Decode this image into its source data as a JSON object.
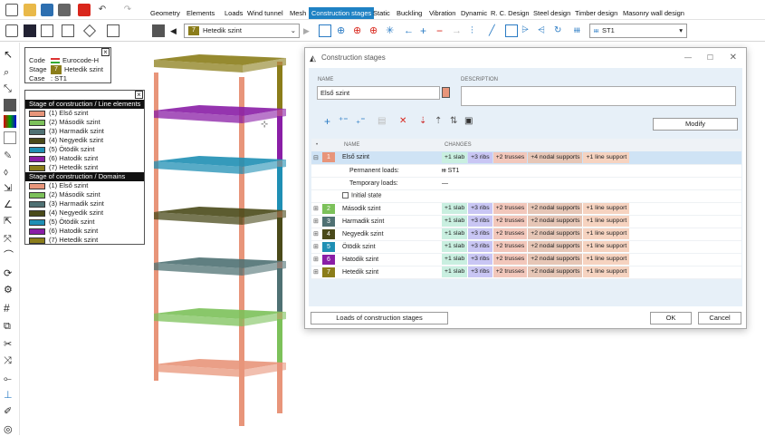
{
  "ribbon_tabs": [
    "Geometry",
    "Elements",
    "Loads",
    "Wind tunnel",
    "Mesh",
    "Construction stages",
    "Static",
    "Buckling",
    "Vibration",
    "Dynamic",
    "R. C. Design",
    "Steel design",
    "Timber design",
    "Masonry wall design"
  ],
  "toolbar": {
    "stage_number": "7",
    "stage_combo": "Hetedik szint",
    "case_combo": "ST1",
    "case_prefix": "ᵻᵻᵻ"
  },
  "info_panel": {
    "code_label": "Code",
    "code_value": "Eurocode-H",
    "stage_label": "Stage",
    "stage_number": "7",
    "stage_value": "Hetedik szint",
    "case_label": "Case",
    "case_value": ": ST1"
  },
  "legend": {
    "head_lines": "Stage of construction / Line elements",
    "head_domains": "Stage of construction / Domains",
    "items": [
      {
        "label": "(1) Első szint",
        "color": "#e8957a"
      },
      {
        "label": "(2) Második szint",
        "color": "#7cc15a"
      },
      {
        "label": "(3) Harmadik szint",
        "color": "#4f7173"
      },
      {
        "label": "(4) Negyedik szint",
        "color": "#4a4a1a"
      },
      {
        "label": "(5) Ötödik szint",
        "color": "#1f8fb4"
      },
      {
        "label": "(6) Hatodik szint",
        "color": "#8a1ea6"
      },
      {
        "label": "(7) Hetedik szint",
        "color": "#8b7d1a"
      }
    ]
  },
  "dialog": {
    "title": "Construction stages",
    "name_label": "NAME",
    "name_value": "Első szint",
    "description_label": "DESCRIPTION",
    "modify_button": "Modify",
    "col_name": "NAME",
    "col_changes": "CHANGES",
    "selected_row": {
      "num": "1",
      "name": "Első szint",
      "changes": [
        "+1 slab",
        "+3 ribs",
        "+2 trusses",
        "+4 nodal supports",
        "+1 line support"
      ],
      "permanent_label": "Permanent loads:",
      "permanent_value": "ᵻᵻᵻ ST1",
      "temporary_label": "Temporary loads:",
      "temporary_value": "—",
      "initial_state_label": "Initial state"
    },
    "rows": [
      {
        "num": "2",
        "name": "Második szint",
        "color": "#7cc15a",
        "changes": [
          "+1 slab",
          "+3 ribs",
          "+2 trusses",
          "+2 nodal supports",
          "+1 line support"
        ]
      },
      {
        "num": "3",
        "name": "Harmadik szint",
        "color": "#4f7173",
        "changes": [
          "+1 slab",
          "+3 ribs",
          "+2 trusses",
          "+2 nodal supports",
          "+1 line support"
        ]
      },
      {
        "num": "4",
        "name": "Negyedik szint",
        "color": "#4a4a1a",
        "changes": [
          "+1 slab",
          "+3 ribs",
          "+2 trusses",
          "+2 nodal supports",
          "+1 line support"
        ]
      },
      {
        "num": "5",
        "name": "Ötödik szint",
        "color": "#1f8fb4",
        "changes": [
          "+1 slab",
          "+3 ribs",
          "+2 trusses",
          "+2 nodal supports",
          "+1 line support"
        ]
      },
      {
        "num": "6",
        "name": "Hatodik szint",
        "color": "#8a1ea6",
        "changes": [
          "+1 slab",
          "+3 ribs",
          "+2 trusses",
          "+2 nodal supports",
          "+1 line support"
        ]
      },
      {
        "num": "7",
        "name": "Hetedik szint",
        "color": "#8b7d1a",
        "changes": [
          "+1 slab",
          "+3 ribs",
          "+2 trusses",
          "+2 nodal supports",
          "+1 line support"
        ]
      }
    ],
    "loads_button": "Loads of construction stages",
    "ok_button": "OK",
    "cancel_button": "Cancel"
  }
}
